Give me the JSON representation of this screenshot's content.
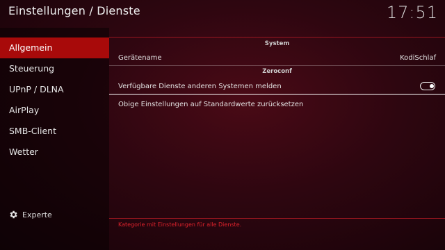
{
  "header": {
    "title": "Einstellungen / Dienste",
    "clock": "17:51"
  },
  "sidebar": {
    "items": [
      {
        "label": "Allgemein",
        "active": true
      },
      {
        "label": "Steuerung"
      },
      {
        "label": "UPnP / DLNA"
      },
      {
        "label": "AirPlay"
      },
      {
        "label": "SMB-Client"
      },
      {
        "label": "Wetter"
      }
    ],
    "level": {
      "label": "Experte",
      "icon": "gear-icon"
    }
  },
  "content": {
    "section_system": "System",
    "device_name_label": "Gerätename",
    "device_name_value": "KodiSchlaf",
    "section_zeroconf": "Zeroconf",
    "announce_label": "Verfügbare Dienste anderen Systemen melden",
    "announce_enabled": true,
    "reset_label": "Obige Einstellungen auf Standardwerte zurücksetzen",
    "hint": "Kategorie mit Einstellungen für alle Dienste."
  },
  "colors": {
    "accent": "#a80a0a",
    "hint": "#e0222c"
  }
}
